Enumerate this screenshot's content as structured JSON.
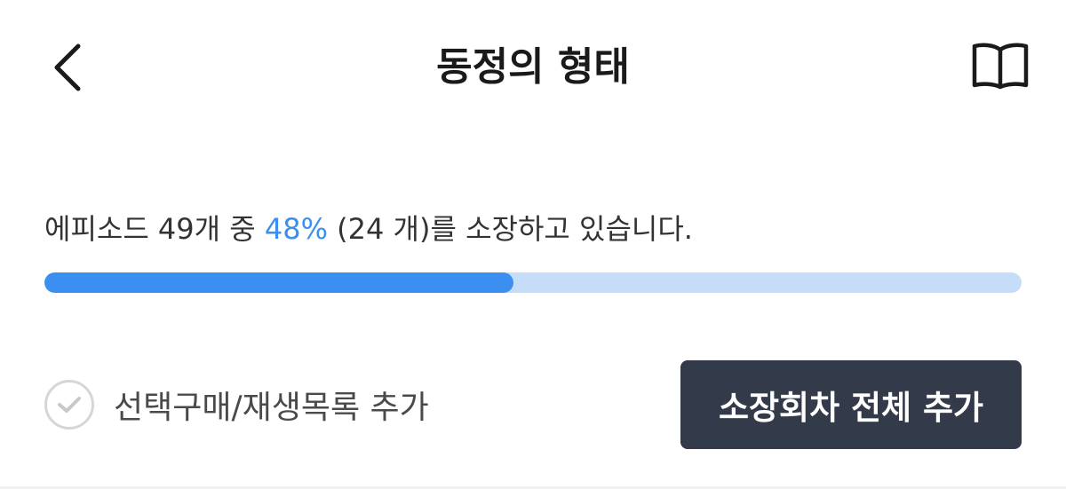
{
  "header": {
    "title": "동정의 형태",
    "back_icon": "chevron-left-icon",
    "book_icon": "open-book-icon"
  },
  "ownership": {
    "text_before": "에피소드 49개 중 ",
    "percent_text": "48%",
    "text_after": " (24 개)를 소장하고 있습니다.",
    "episodes_total": 49,
    "episodes_owned": 24,
    "progress_percent": 48
  },
  "actions": {
    "select_label": "선택구매/재생목록 추가",
    "select_icon": "check-circle-icon",
    "add_all_label": "소장회차 전체 추가"
  },
  "colors": {
    "accent": "#3a8ff0",
    "track": "#c6ddfa",
    "button_bg": "#333b4a"
  }
}
